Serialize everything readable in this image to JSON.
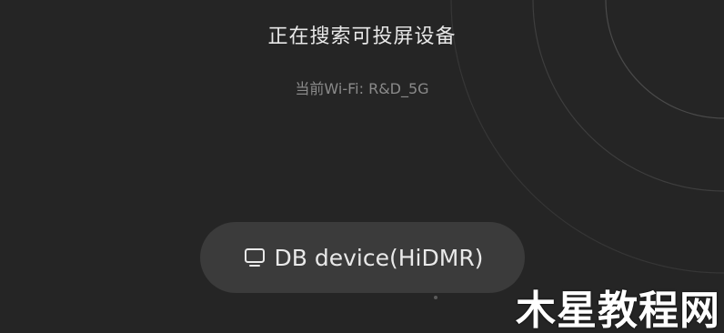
{
  "screen": {
    "title": "正在搜索可投屏设备",
    "wifi_label": "当前Wi-Fi: R&D_5G"
  },
  "devices": [
    {
      "name": "DB device(HiDMR)",
      "icon": "tv-icon"
    }
  ],
  "watermark": "木星教程网",
  "colors": {
    "background": "#252525",
    "pill": "#3b3b3b",
    "text_primary": "#e8e8e8",
    "text_secondary": "#8a8a8a"
  }
}
